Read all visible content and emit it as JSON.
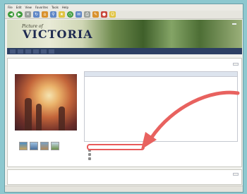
{
  "browser": {
    "menu": [
      "File",
      "Edit",
      "View",
      "Favorites",
      "Tools",
      "Help"
    ]
  },
  "banner": {
    "logo_small": "Picture of",
    "logo": "VICTORIA",
    "tagline": "",
    "lang_link": ""
  },
  "nav": [],
  "panel": {
    "title": "",
    "top_link": "",
    "caption": "",
    "details_head": "",
    "fields": [],
    "description": "",
    "actions": []
  },
  "panel2": {
    "title": "",
    "link": ""
  },
  "status": {
    "items": [],
    "right": ""
  },
  "colors": {
    "page_bg": "#8dc8cf",
    "nav_bg": "#2d3f63",
    "arrow": "#e8625f"
  }
}
